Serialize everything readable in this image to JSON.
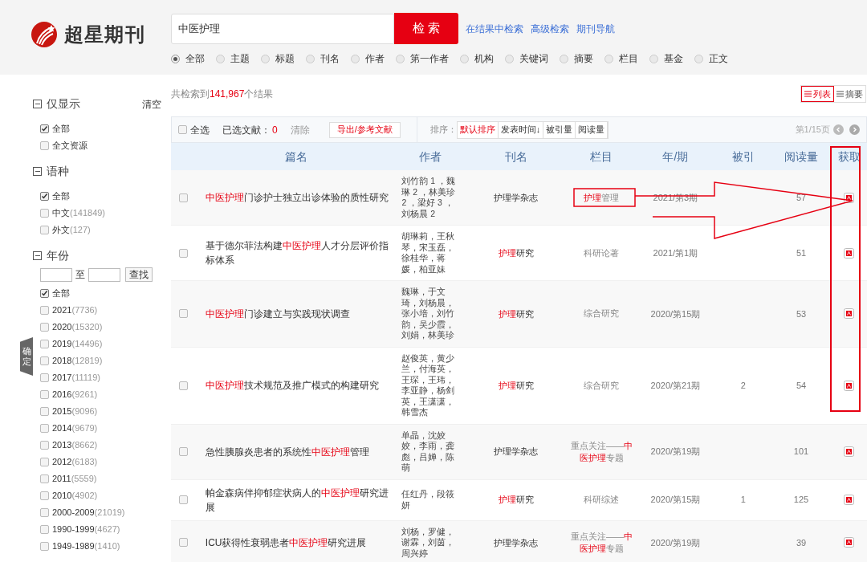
{
  "logo": {
    "name": "超星期刊"
  },
  "search": {
    "value": "中医护理",
    "button": "检 索",
    "links": [
      "在结果中检索",
      "高级检索",
      "期刊导航"
    ],
    "fields": [
      {
        "label": "全部",
        "selected": true
      },
      {
        "label": "主题",
        "selected": false
      },
      {
        "label": "标题",
        "selected": false
      },
      {
        "label": "刊名",
        "selected": false
      },
      {
        "label": "作者",
        "selected": false
      },
      {
        "label": "第一作者",
        "selected": false
      },
      {
        "label": "机构",
        "selected": false
      },
      {
        "label": "关键词",
        "selected": false
      },
      {
        "label": "摘要",
        "selected": false
      },
      {
        "label": "栏目",
        "selected": false
      },
      {
        "label": "基金",
        "selected": false
      },
      {
        "label": "正文",
        "selected": false
      }
    ]
  },
  "sidebar": {
    "clear": "清空",
    "confirm": "确定",
    "sections": [
      {
        "title": "仅显示",
        "expanded": true,
        "items": [
          {
            "label": "全部",
            "checked": true
          },
          {
            "label": "全文资源",
            "checked": false
          }
        ]
      },
      {
        "title": "语种",
        "expanded": true,
        "items": [
          {
            "label": "全部",
            "checked": true
          },
          {
            "label": "中文",
            "count": "(141849)",
            "checked": false
          },
          {
            "label": "外文",
            "count": "(127)",
            "checked": false
          }
        ]
      },
      {
        "title": "年份",
        "expanded": true,
        "range": {
          "to": "至",
          "button": "查找"
        },
        "items": [
          {
            "label": "全部",
            "checked": true
          },
          {
            "label": "2021",
            "count": "(7736)",
            "checked": false
          },
          {
            "label": "2020",
            "count": "(15320)",
            "checked": false
          },
          {
            "label": "2019",
            "count": "(14496)",
            "checked": false
          },
          {
            "label": "2018",
            "count": "(12819)",
            "checked": false
          },
          {
            "label": "2017",
            "count": "(11119)",
            "checked": false
          },
          {
            "label": "2016",
            "count": "(9261)",
            "checked": false
          },
          {
            "label": "2015",
            "count": "(9096)",
            "checked": false
          },
          {
            "label": "2014",
            "count": "(9679)",
            "checked": false
          },
          {
            "label": "2013",
            "count": "(8662)",
            "checked": false
          },
          {
            "label": "2012",
            "count": "(6183)",
            "checked": false
          },
          {
            "label": "2011",
            "count": "(5559)",
            "checked": false
          },
          {
            "label": "2010",
            "count": "(4902)",
            "checked": false
          },
          {
            "label": "2000-2009",
            "count": "(21019)",
            "checked": false
          },
          {
            "label": "1990-1999",
            "count": "(4627)",
            "checked": false
          },
          {
            "label": "1949-1989",
            "count": "(1410)",
            "checked": false
          }
        ]
      }
    ]
  },
  "summary": {
    "prefix": "共检索到",
    "count": "141,967",
    "suffix": "个结果"
  },
  "views": [
    {
      "label": "列表",
      "selected": true
    },
    {
      "label": "摘要",
      "selected": false
    }
  ],
  "toolbar": {
    "select_all": {
      "label": "全选",
      "checked": false
    },
    "selected_label": "已选文献：",
    "selected_count": "0",
    "clear": "清除",
    "export": "导出/参考文献",
    "sort_label": "排序：",
    "sorts": [
      {
        "label": "默认排序",
        "selected": true
      },
      {
        "label": "发表时间↓",
        "selected": false
      },
      {
        "label": "被引量",
        "selected": false
      },
      {
        "label": "阅读量",
        "selected": false
      }
    ],
    "page": "第1/15页"
  },
  "table": {
    "columns": [
      "篇名",
      "作者",
      "刊名",
      "栏目",
      "年/期",
      "被引",
      "阅读量",
      "获取"
    ],
    "rows": [
      {
        "checked": false,
        "title": [
          {
            "text": "中医护理",
            "hl": true
          },
          {
            "text": "门诊护士独立出诊体验的质性研究",
            "hl": false
          }
        ],
        "authors": "刘竹韵 1 ，魏琳 2 ，林美珍 2 ，梁好 3 ，刘杨晨 2",
        "journal": [
          {
            "text": "护理学杂志",
            "hl": false
          }
        ],
        "section": [
          {
            "text": "护理",
            "hl": true
          },
          {
            "text": "管理",
            "hl": false
          }
        ],
        "issue": "2021/第3期",
        "reads": "57"
      },
      {
        "checked": false,
        "title": [
          {
            "text": "基于德尔菲法构建",
            "hl": false
          },
          {
            "text": "中医护理",
            "hl": true
          },
          {
            "text": "人才分层评价指标体系",
            "hl": false
          }
        ],
        "authors": "胡琳莉，王秋琴，宋玉磊，徐桂华，蒋媛，柏亚妹",
        "journal": [
          {
            "text": "护理",
            "hl": true
          },
          {
            "text": "研究",
            "hl": false
          }
        ],
        "section": [
          {
            "text": "科研论著",
            "hl": false
          }
        ],
        "issue": "2021/第1期",
        "reads": "51"
      },
      {
        "checked": false,
        "title": [
          {
            "text": "中医护理",
            "hl": true
          },
          {
            "text": "门诊建立与实践现状调查",
            "hl": false
          }
        ],
        "authors": "魏琳，于文琦，刘杨晨，张小培，刘竹韵，吴少霞，刘娟，林美珍",
        "journal": [
          {
            "text": "护理",
            "hl": true
          },
          {
            "text": "研究",
            "hl": false
          }
        ],
        "section": [
          {
            "text": "综合研究",
            "hl": false
          }
        ],
        "issue": "2020/第15期",
        "reads": "53"
      },
      {
        "checked": false,
        "title": [
          {
            "text": "中医护理",
            "hl": true
          },
          {
            "text": "技术规范及推广模式的构建研究",
            "hl": false
          }
        ],
        "authors": "赵俊英，黄少兰，付海英，王琛，王玮，李亚静，杨剑英，王潇潇，韩雪杰",
        "journal": [
          {
            "text": "护理",
            "hl": true
          },
          {
            "text": "研究",
            "hl": false
          }
        ],
        "section": [
          {
            "text": "综合研究",
            "hl": false
          }
        ],
        "issue": "2020/第21期",
        "cited": "2",
        "reads": "54"
      },
      {
        "checked": false,
        "title": [
          {
            "text": "急性胰腺炎患者的系统性",
            "hl": false
          },
          {
            "text": "中医护理",
            "hl": true
          },
          {
            "text": "管理",
            "hl": false
          }
        ],
        "authors": "单晶，沈姣姣，李雨，龚彪，吕婵，陈萌",
        "journal": [
          {
            "text": "护理学杂志",
            "hl": false
          }
        ],
        "section": [
          {
            "text": "重点关注——",
            "hl": false
          },
          {
            "text": "中医护理",
            "hl": true
          },
          {
            "text": "专题",
            "hl": false
          }
        ],
        "issue": "2020/第19期",
        "reads": "101"
      },
      {
        "checked": false,
        "title": [
          {
            "text": "帕金森病伴抑郁症状病人的",
            "hl": false
          },
          {
            "text": "中医护理",
            "hl": true
          },
          {
            "text": "研究进展",
            "hl": false
          }
        ],
        "authors": "任红丹，段筱妍",
        "journal": [
          {
            "text": "护理",
            "hl": true
          },
          {
            "text": "研究",
            "hl": false
          }
        ],
        "section": [
          {
            "text": "科研综述",
            "hl": false
          }
        ],
        "issue": "2020/第15期",
        "cited": "1",
        "reads": "125"
      },
      {
        "checked": false,
        "title": [
          {
            "text": "ICU获得性衰弱患者",
            "hl": false
          },
          {
            "text": "中医护理",
            "hl": true
          },
          {
            "text": "研究进展",
            "hl": false
          }
        ],
        "authors": "刘杨，罗健，谢霖，刘茵，周兴婷",
        "journal": [
          {
            "text": "护理学杂志",
            "hl": false
          }
        ],
        "section": [
          {
            "text": "重点关注——",
            "hl": false
          },
          {
            "text": "中医护理",
            "hl": true
          },
          {
            "text": "专题",
            "hl": false
          }
        ],
        "issue": "2020/第19期",
        "reads": "39"
      }
    ]
  }
}
